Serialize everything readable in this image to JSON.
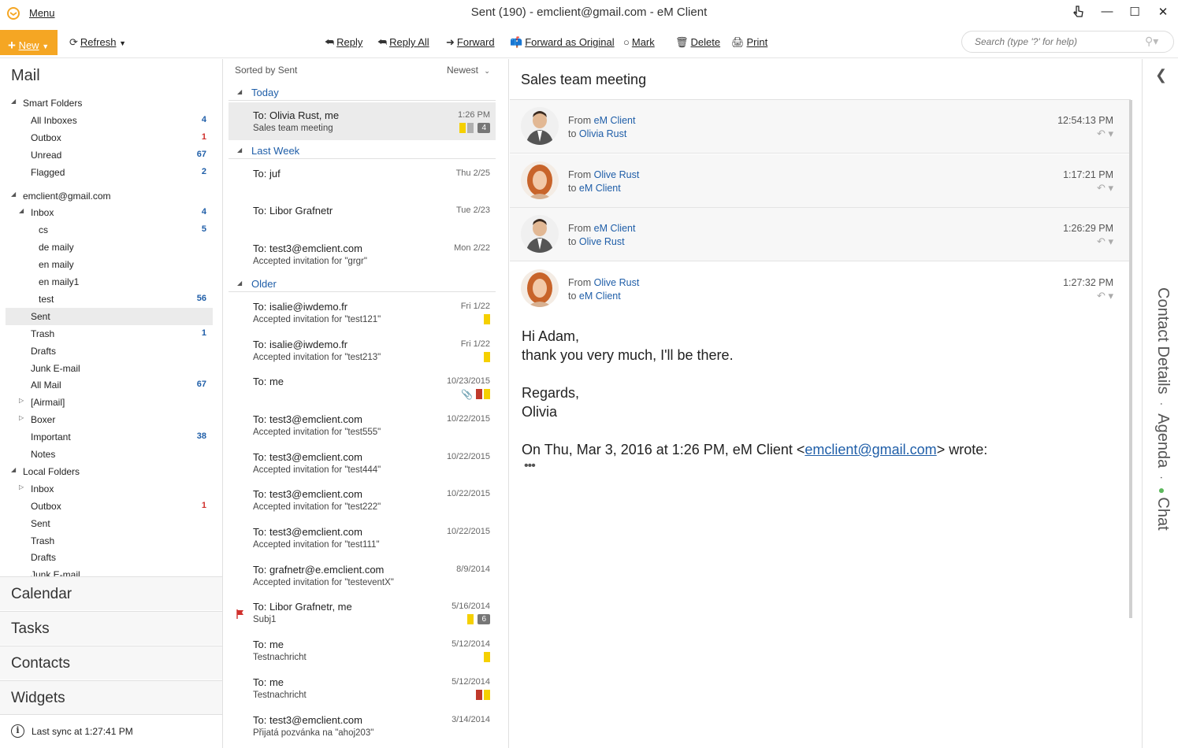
{
  "window": {
    "menu_label": "Menu",
    "title": "Sent (190) - emclient@gmail.com - eM Client"
  },
  "toolbar": {
    "new_label": "New",
    "refresh_label": "Refresh",
    "reply_label": "Reply",
    "reply_all_label": "Reply All",
    "forward_label": "Forward",
    "forward_original_label": "Forward as Original",
    "mark_label": "Mark",
    "delete_label": "Delete",
    "print_label": "Print",
    "search_placeholder": "Search (type '?' for help)"
  },
  "sidebar": {
    "title": "Mail",
    "folders": [
      {
        "label": "Smart Folders",
        "count": "",
        "level": 0,
        "toggle": "open"
      },
      {
        "label": "All Inboxes",
        "count": "4",
        "level": 1,
        "toggle": ""
      },
      {
        "label": "Outbox",
        "count": "1",
        "level": 1,
        "toggle": "",
        "count_color": "red"
      },
      {
        "label": "Unread",
        "count": "67",
        "level": 1,
        "toggle": ""
      },
      {
        "label": "Flagged",
        "count": "2",
        "level": 1,
        "toggle": ""
      },
      {
        "label": "emclient@gmail.com",
        "count": "",
        "level": 0,
        "toggle": "open",
        "space_before": true
      },
      {
        "label": "Inbox",
        "count": "4",
        "level": 1,
        "toggle": "open"
      },
      {
        "label": "cs",
        "count": "5",
        "level": 2,
        "toggle": ""
      },
      {
        "label": "de maily",
        "count": "",
        "level": 2,
        "toggle": ""
      },
      {
        "label": "en maily",
        "count": "",
        "level": 2,
        "toggle": ""
      },
      {
        "label": "en maily1",
        "count": "",
        "level": 2,
        "toggle": ""
      },
      {
        "label": "test",
        "count": "56",
        "level": 2,
        "toggle": ""
      },
      {
        "label": "Sent",
        "count": "",
        "level": 1,
        "toggle": "",
        "selected": true
      },
      {
        "label": "Trash",
        "count": "1",
        "level": 1,
        "toggle": ""
      },
      {
        "label": "Drafts",
        "count": "",
        "level": 1,
        "toggle": ""
      },
      {
        "label": "Junk E-mail",
        "count": "",
        "level": 1,
        "toggle": ""
      },
      {
        "label": "All Mail",
        "count": "67",
        "level": 1,
        "toggle": ""
      },
      {
        "label": "[Airmail]",
        "count": "",
        "level": 1,
        "toggle": "closed"
      },
      {
        "label": "Boxer",
        "count": "",
        "level": 1,
        "toggle": "closed"
      },
      {
        "label": "Important",
        "count": "38",
        "level": 1,
        "toggle": ""
      },
      {
        "label": "Notes",
        "count": "",
        "level": 1,
        "toggle": ""
      },
      {
        "label": "Local Folders",
        "count": "",
        "level": 0,
        "toggle": "open"
      },
      {
        "label": "Inbox",
        "count": "",
        "level": 1,
        "toggle": "closed"
      },
      {
        "label": "Outbox",
        "count": "1",
        "level": 1,
        "toggle": "",
        "count_color": "red"
      },
      {
        "label": "Sent",
        "count": "",
        "level": 1,
        "toggle": ""
      },
      {
        "label": "Trash",
        "count": "",
        "level": 1,
        "toggle": ""
      },
      {
        "label": "Drafts",
        "count": "",
        "level": 1,
        "toggle": ""
      },
      {
        "label": "Junk E-mail",
        "count": "",
        "level": 1,
        "toggle": ""
      }
    ],
    "nav_sections": [
      "Calendar",
      "Tasks",
      "Contacts",
      "Widgets"
    ],
    "status": "Last sync at 1:27:41 PM"
  },
  "message_list": {
    "sort_label": "Sorted by Sent",
    "sort_order": "Newest",
    "groups": [
      {
        "label": "Today",
        "messages": [
          {
            "to": "To: Olivia Rust, me",
            "subject": "Sales team meeting",
            "date": "1:26 PM",
            "tags": [
              "#f5d000",
              "#b0b0b0"
            ],
            "thread_count": "4",
            "selected": true
          }
        ]
      },
      {
        "label": "Last Week",
        "messages": [
          {
            "to": "To: juf",
            "subject": "",
            "date": "Thu 2/25",
            "tags": []
          },
          {
            "to": "To: Libor Grafnetr",
            "subject": "",
            "date": "Tue 2/23",
            "tags": []
          },
          {
            "to": "To: test3@emclient.com",
            "subject": "Accepted invitation for \"grgr\"",
            "date": "Mon 2/22",
            "tags": []
          }
        ]
      },
      {
        "label": "Older",
        "messages": [
          {
            "to": "To: isalie@iwdemo.fr",
            "subject": "Accepted invitation for \"test121\"",
            "date": "Fri 1/22",
            "tags": [
              "#f5d000"
            ]
          },
          {
            "to": "To: isalie@iwdemo.fr",
            "subject": "Accepted invitation for \"test213\"",
            "date": "Fri 1/22",
            "tags": [
              "#f5d000"
            ]
          },
          {
            "to": "To: me",
            "subject": "",
            "date": "10/23/2015",
            "tags": [
              "#c0392b",
              "#f5d000"
            ],
            "attachment": true
          },
          {
            "to": "To: test3@emclient.com",
            "subject": "Accepted invitation for \"test555\"",
            "date": "10/22/2015",
            "tags": []
          },
          {
            "to": "To: test3@emclient.com",
            "subject": "Accepted invitation for \"test444\"",
            "date": "10/22/2015",
            "tags": []
          },
          {
            "to": "To: test3@emclient.com",
            "subject": "Accepted invitation for \"test222\"",
            "date": "10/22/2015",
            "tags": []
          },
          {
            "to": "To: test3@emclient.com",
            "subject": "Accepted invitation for \"test111\"",
            "date": "10/22/2015",
            "tags": []
          },
          {
            "to": "To: grafnetr@e.emclient.com",
            "subject": "Accepted invitation for \"testeventX\"",
            "date": "8/9/2014",
            "tags": []
          },
          {
            "to": "To: Libor Grafnetr, me",
            "subject": "Subj1",
            "date": "5/16/2014",
            "tags": [
              "#f5d000"
            ],
            "thread_count": "6",
            "flagged": true
          },
          {
            "to": "To: me",
            "subject": "Testnachricht",
            "date": "5/12/2014",
            "tags": [
              "#f5d000"
            ]
          },
          {
            "to": "To: me",
            "subject": "Testnachricht",
            "date": "5/12/2014",
            "tags": [
              "#c0392b",
              "#f5d000"
            ]
          },
          {
            "to": "To: test3@emclient.com",
            "subject": "Přijatá pozvánka na \"ahoj203\"",
            "date": "3/14/2014",
            "tags": []
          }
        ]
      }
    ]
  },
  "reader": {
    "subject": "Sales team meeting",
    "headers": [
      {
        "from": "eM Client",
        "to": "Olivia Rust",
        "time": "12:54:13 PM",
        "avatar": "man"
      },
      {
        "from": "Olive Rust",
        "to": "eM Client",
        "time": "1:17:21 PM",
        "avatar": "woman"
      },
      {
        "from": "eM Client",
        "to": "Olive Rust",
        "time": "1:26:29 PM",
        "avatar": "man"
      },
      {
        "from": "Olive Rust",
        "to": "eM Client",
        "time": "1:27:32 PM",
        "avatar": "woman"
      }
    ],
    "from_prefix": "From",
    "to_prefix": "to",
    "body": {
      "greeting": "Hi Adam,",
      "line1": "thank you very much, I'll be there.",
      "regards": "Regards,",
      "signature": "Olivia",
      "quote_prefix": "On Thu, Mar 3, 2016 at 1:26 PM, eM Client <",
      "quote_email": "emclient@gmail.com",
      "quote_suffix": "> wrote:",
      "ellipsis": "•••"
    }
  },
  "side_panel": {
    "tabs": [
      "Contact Details",
      "Agenda",
      "Chat"
    ]
  },
  "colors": {
    "accent": "#f5a623",
    "link": "#1f5ea8",
    "count_red": "#d0312d"
  }
}
